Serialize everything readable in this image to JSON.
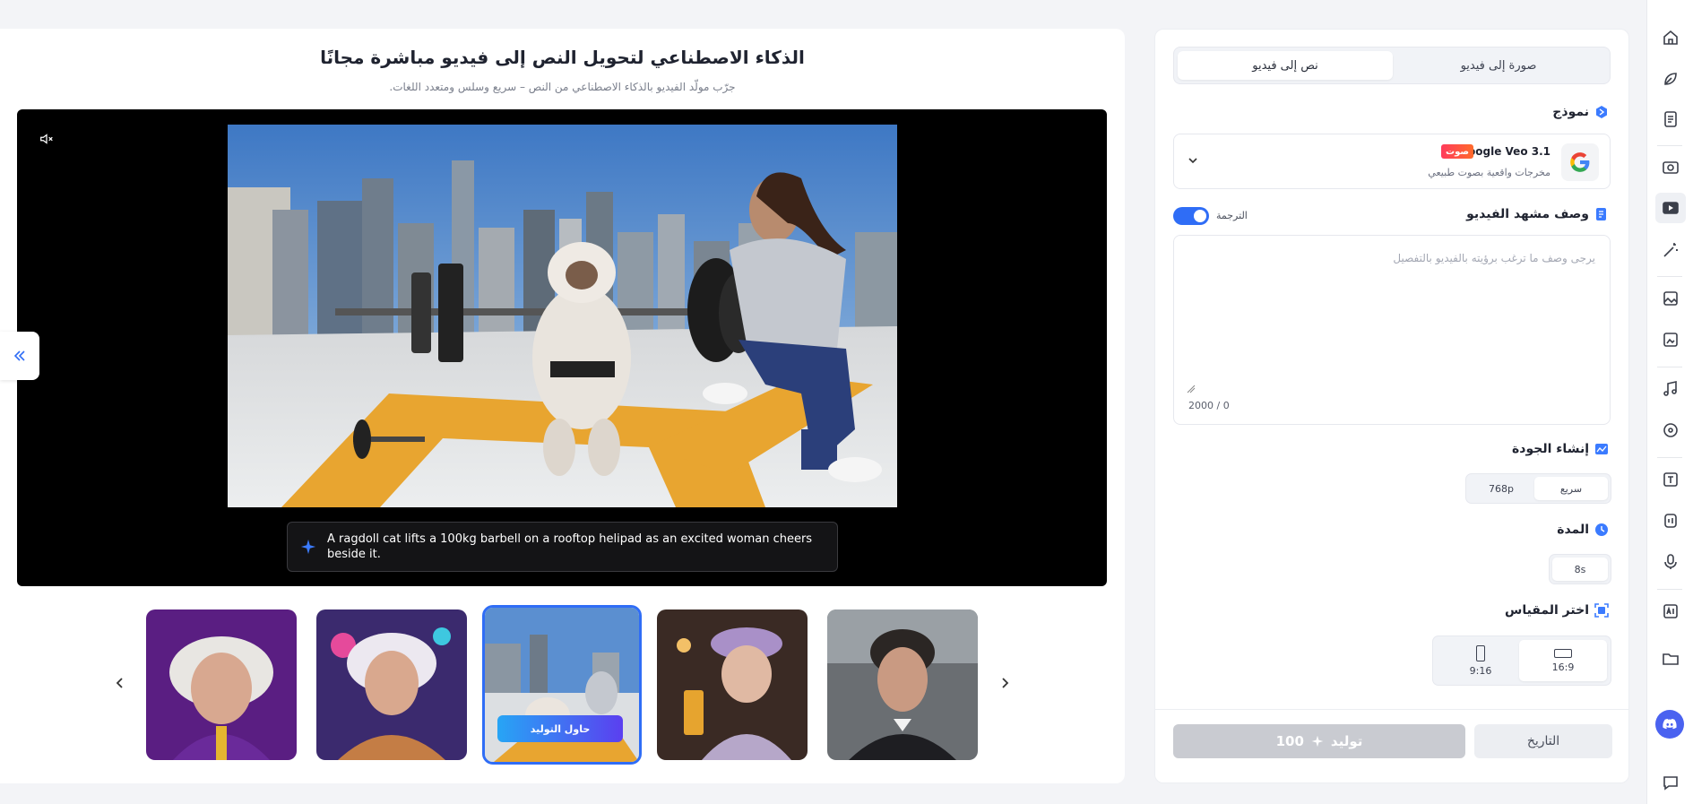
{
  "hero": {
    "title": "الذكاء الاصطناعي لتحويل النص إلى فيديو مباشرة مجانًا",
    "subtitle": "جرّب مولّد الفيديو بالذكاء الاصطناعي من النص – سريع وسلس ومتعدد اللغات."
  },
  "video": {
    "caption": "A ragdoll cat lifts a 100kg barbell on a rooftop helipad as an excited woman cheers beside it."
  },
  "thumbnails": {
    "try_label": "حاول التوليد"
  },
  "panel": {
    "tabs": {
      "active": "نص إلى فيديو",
      "inactive": "صورة إلى فيديو"
    },
    "model": {
      "section_title": "نموذج",
      "name": "Google Veo 3.1",
      "badge": "صوت",
      "description": "مخرجات واقعية بصوت طبيعي"
    },
    "scene": {
      "section_title": "وصف مشهد الفيديو",
      "translate_label": "الترجمة",
      "placeholder": "يرجى وصف ما ترغب برؤيته بالفيديو بالتفصيل",
      "counter": "2000 / 0"
    },
    "quality": {
      "section_title": "إنشاء الجودة",
      "options": [
        "سريع",
        "768p"
      ]
    },
    "duration": {
      "section_title": "المدة",
      "value": "8s"
    },
    "ratio": {
      "section_title": "اختر المقياس",
      "options": [
        "16:9",
        "9:16"
      ]
    },
    "footer": {
      "generate_label": "توليد",
      "credits": "100",
      "history_label": "التاريخ"
    }
  },
  "colors": {
    "accent": "#2f6df6",
    "badge": "#ff3b5c",
    "disabled": "#c9cbd1"
  },
  "icons": {
    "rail": [
      "home-icon",
      "leaf-icon",
      "document-icon",
      "image-to-video-icon",
      "video-icon",
      "magic-wand-icon",
      "image-icon",
      "image-edit-icon",
      "music-icon",
      "disc-icon",
      "translate-icon",
      "audio-icon",
      "microphone-icon",
      "ai-icon",
      "folder-icon",
      "discord-icon",
      "chat-icon"
    ]
  }
}
